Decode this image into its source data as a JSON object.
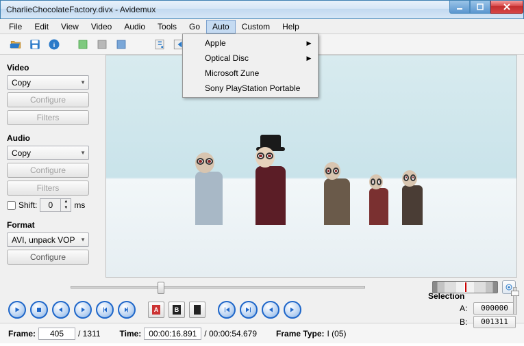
{
  "window": {
    "title": "CharlieChocolateFactory.divx - Avidemux"
  },
  "menu": {
    "items": [
      "File",
      "Edit",
      "View",
      "Video",
      "Audio",
      "Tools",
      "Go",
      "Auto",
      "Custom",
      "Help"
    ],
    "open_index": 7,
    "popup": [
      {
        "label": "Apple",
        "submenu": true
      },
      {
        "label": "Optical Disc",
        "submenu": true
      },
      {
        "label": "Microsoft Zune",
        "submenu": false
      },
      {
        "label": "Sony PlayStation Portable",
        "submenu": false
      }
    ]
  },
  "sidebar": {
    "video": {
      "title": "Video",
      "codec": "Copy",
      "configure": "Configure",
      "filters": "Filters"
    },
    "audio": {
      "title": "Audio",
      "codec": "Copy",
      "configure": "Configure",
      "filters": "Filters",
      "shift_label": "Shift:",
      "shift_value": "0",
      "shift_unit": "ms"
    },
    "format": {
      "title": "Format",
      "container": "AVI, unpack VOP",
      "configure": "Configure"
    }
  },
  "selection": {
    "title": "Selection",
    "a_label": "A:",
    "a_value": "000000",
    "b_label": "B:",
    "b_value": "001311"
  },
  "status": {
    "frame_label": "Frame:",
    "frame_value": "405",
    "frame_total": "/ 1311",
    "time_label": "Time:",
    "time_value": "00:00:16.891",
    "time_total": "/ 00:00:54.679",
    "frametype_label": "Frame Type:",
    "frametype_value": "I (05)"
  },
  "marker": {
    "a": "A",
    "b": "B"
  }
}
